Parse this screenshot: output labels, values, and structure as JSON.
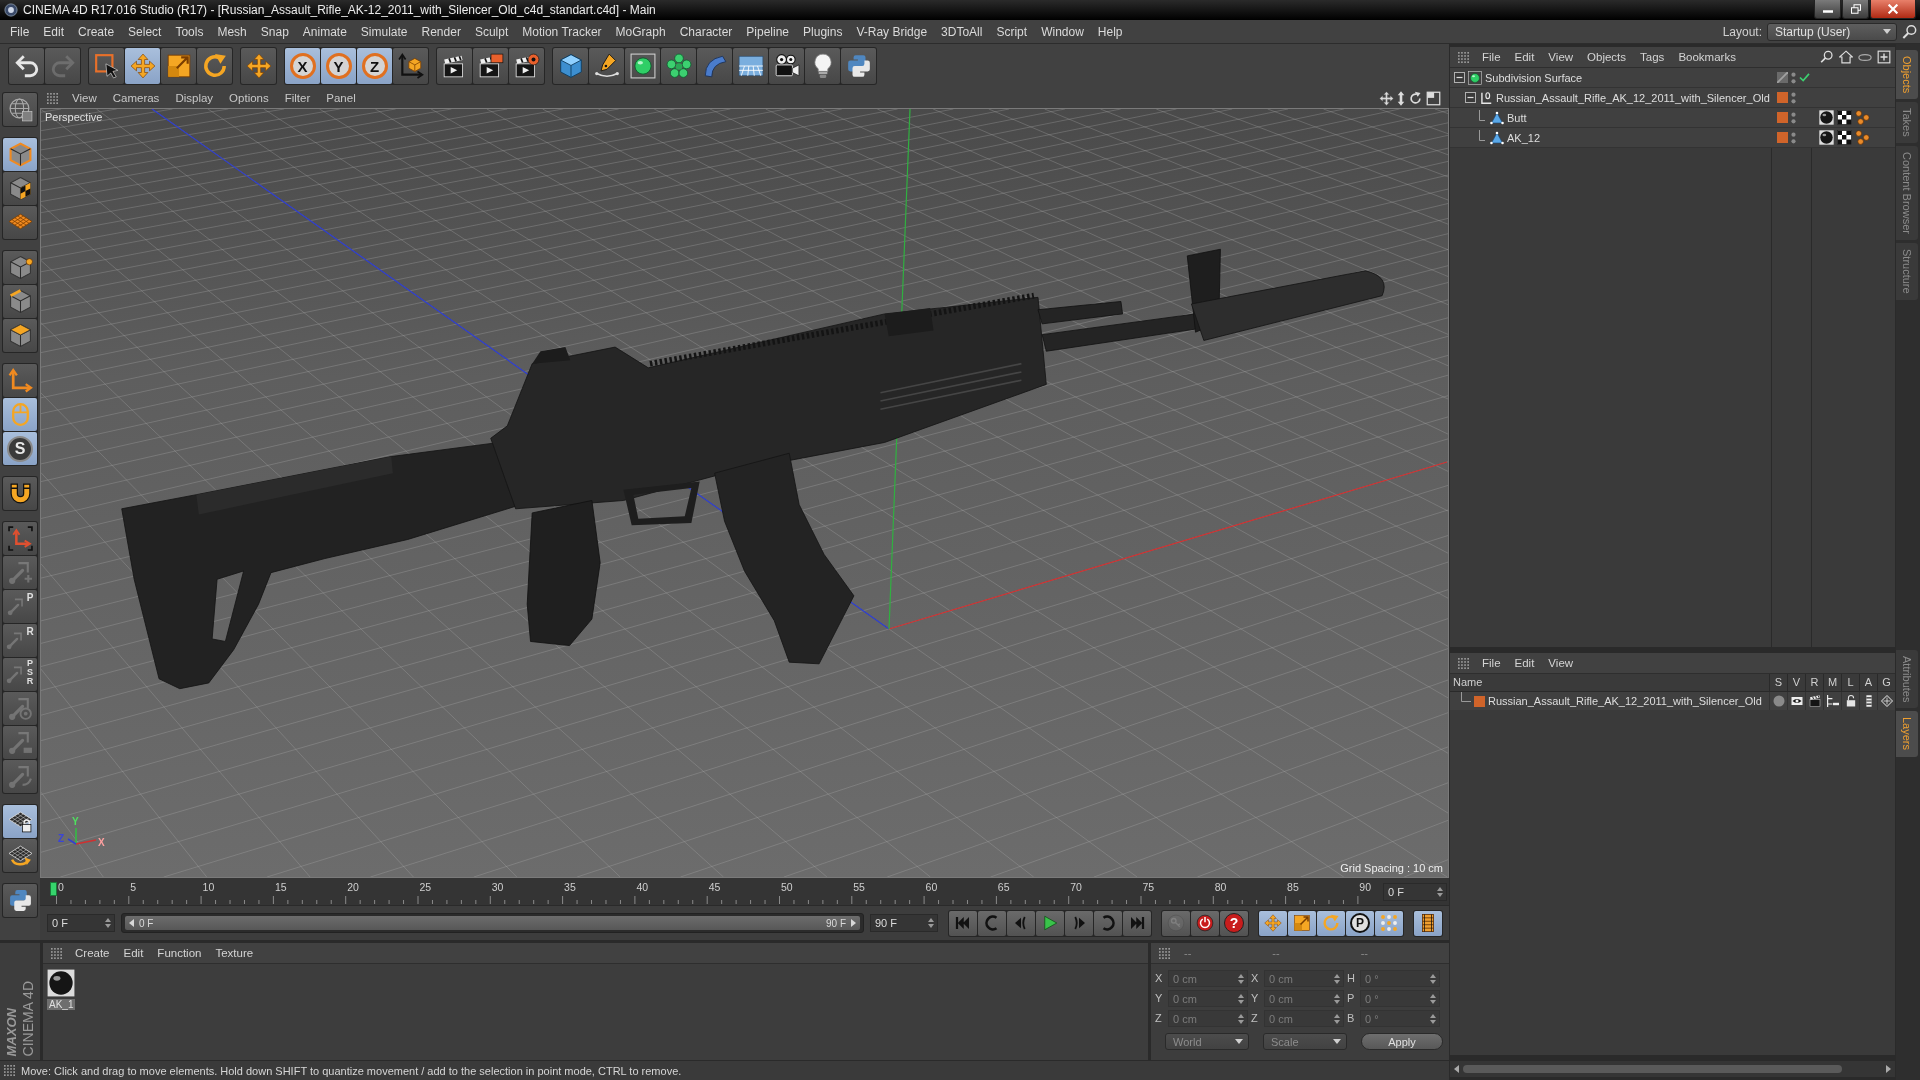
{
  "window": {
    "title": "CINEMA 4D R17.016 Studio (R17) - [Russian_Assault_Rifle_AK-12_2011_with_Silencer_Old_c4d_standart.c4d] - Main"
  },
  "menu_bar": {
    "items": [
      "File",
      "Edit",
      "Create",
      "Select",
      "Tools",
      "Mesh",
      "Snap",
      "Animate",
      "Simulate",
      "Render",
      "Sculpt",
      "Motion Tracker",
      "MoGraph",
      "Character",
      "Pipeline",
      "Plugins",
      "V-Ray Bridge",
      "3DToAll",
      "Script",
      "Window",
      "Help"
    ],
    "layout_label": "Layout:",
    "layout_value": "Startup (User)"
  },
  "toolbar": {
    "groups": [
      [
        {
          "kind": "undo",
          "selected": false,
          "disabled": false
        },
        {
          "kind": "redo",
          "selected": false,
          "disabled": true
        }
      ],
      [
        {
          "kind": "select",
          "selected": false,
          "disabled": false
        },
        {
          "kind": "move",
          "selected": true,
          "disabled": false
        },
        {
          "kind": "scale",
          "selected": false,
          "disabled": false
        },
        {
          "kind": "rotate",
          "selected": false,
          "disabled": false
        }
      ],
      [
        {
          "kind": "recent",
          "selected": false,
          "disabled": false
        }
      ],
      [
        {
          "kind": "x-axis",
          "label": "X",
          "selected": true,
          "disabled": false
        },
        {
          "kind": "y-axis",
          "label": "Y",
          "selected": true,
          "disabled": false
        },
        {
          "kind": "z-axis",
          "label": "Z",
          "selected": true,
          "disabled": false
        },
        {
          "kind": "coordinates",
          "selected": false,
          "disabled": false
        }
      ],
      [
        {
          "kind": "render-view",
          "selected": false,
          "disabled": false
        },
        {
          "kind": "render-picture",
          "selected": false,
          "disabled": false
        },
        {
          "kind": "render-settings",
          "selected": false,
          "disabled": false
        }
      ],
      [
        {
          "kind": "cube",
          "selected": false,
          "disabled": false
        },
        {
          "kind": "pen",
          "selected": false,
          "disabled": false
        },
        {
          "kind": "subdivision",
          "selected": false,
          "disabled": false
        },
        {
          "kind": "cloner",
          "selected": false,
          "disabled": false
        },
        {
          "kind": "deformer",
          "selected": false,
          "disabled": false
        },
        {
          "kind": "floor",
          "selected": false,
          "disabled": false
        },
        {
          "kind": "camera",
          "selected": false,
          "disabled": false
        },
        {
          "kind": "light",
          "selected": false,
          "disabled": false
        },
        {
          "kind": "python",
          "selected": false,
          "disabled": false
        }
      ]
    ]
  },
  "left_toolbar": {
    "groups": [
      [
        {
          "kind": "globe",
          "selected": false,
          "disabled": false
        }
      ],
      [
        {
          "kind": "model",
          "selected": true,
          "disabled": false
        },
        {
          "kind": "texture",
          "selected": false,
          "disabled": false
        },
        {
          "kind": "workplane",
          "selected": false,
          "disabled": false
        }
      ],
      [
        {
          "kind": "points",
          "selected": false,
          "disabled": false
        },
        {
          "kind": "edges",
          "selected": false,
          "disabled": false
        },
        {
          "kind": "polygons",
          "selected": false,
          "disabled": false
        }
      ],
      [
        {
          "kind": "axis",
          "selected": false,
          "disabled": false
        },
        {
          "kind": "tweak",
          "selected": true,
          "disabled": false
        },
        {
          "kind": "snap",
          "label": "S",
          "selected": true,
          "disabled": false
        }
      ],
      [
        {
          "kind": "magnet",
          "selected": false,
          "disabled": false
        }
      ],
      [
        {
          "kind": "workplane-axis",
          "selected": false,
          "disabled": false
        },
        {
          "kind": "bone-add",
          "selected": false,
          "disabled": true
        },
        {
          "kind": "bone-position",
          "label": "P",
          "selected": false,
          "disabled": true
        },
        {
          "kind": "bone-rotation",
          "label": "R",
          "selected": false,
          "disabled": true
        },
        {
          "kind": "bone-psr",
          "label": "PSR",
          "selected": false,
          "disabled": true
        },
        {
          "kind": "bone-target",
          "selected": false,
          "disabled": true
        },
        {
          "kind": "bone-ik",
          "selected": false,
          "disabled": true
        },
        {
          "kind": "bone-bend",
          "selected": false,
          "disabled": true
        }
      ],
      [
        {
          "kind": "grid-lock",
          "selected": true,
          "disabled": false
        },
        {
          "kind": "grid-rotate",
          "selected": false,
          "disabled": false
        }
      ],
      [
        {
          "kind": "python",
          "selected": false,
          "disabled": false
        }
      ]
    ]
  },
  "viewport": {
    "menu": [
      "View",
      "Cameras",
      "Display",
      "Options",
      "Filter",
      "Panel"
    ],
    "camera": "Perspective",
    "grid_spacing": "Grid Spacing : 10 cm",
    "axis_labels": [
      "Y",
      "Z",
      "X"
    ]
  },
  "timeline": {
    "ticks": [
      "0",
      "5",
      "10",
      "15",
      "20",
      "25",
      "30",
      "35",
      "40",
      "45",
      "50",
      "55",
      "60",
      "65",
      "70",
      "75",
      "80",
      "85",
      "90"
    ],
    "level": 0,
    "current_frame": "0 F",
    "start": "0 F",
    "range": {
      "start": "0 F",
      "end": "90 F",
      "level": 1
    },
    "end": "90 F",
    "playback": [
      {
        "kind": "go-start",
        "selected": false,
        "disabled": false
      },
      {
        "kind": "previous-key",
        "selected": false,
        "disabled": false
      },
      {
        "kind": "previous-frame",
        "selected": false,
        "disabled": false
      },
      {
        "kind": "play",
        "selected": false,
        "disabled": false
      },
      {
        "kind": "next-frame",
        "selected": false,
        "disabled": false
      },
      {
        "kind": "next-key",
        "selected": false,
        "disabled": false
      },
      {
        "kind": "go-end",
        "selected": false,
        "disabled": false
      }
    ],
    "record": [
      {
        "kind": "record-objects",
        "selected": false,
        "disabled": true
      },
      {
        "kind": "autokey",
        "selected": false,
        "disabled": false
      },
      {
        "kind": "keyframe-selection",
        "label": "?",
        "selected": false,
        "disabled": false
      }
    ],
    "keys": [
      {
        "kind": "key-position",
        "selected": true,
        "disabled": false
      },
      {
        "kind": "key-scale",
        "selected": true,
        "disabled": false
      },
      {
        "kind": "key-rotation",
        "selected": true,
        "disabled": false
      },
      {
        "kind": "key-parameter",
        "label": "P",
        "selected": true,
        "disabled": false
      },
      {
        "kind": "key-point-level",
        "selected": true,
        "disabled": false
      }
    ],
    "view": [
      {
        "kind": "timeline-view",
        "selected": true,
        "disabled": false
      }
    ]
  },
  "materials": {
    "menu": [
      "Create",
      "Edit",
      "Function",
      "Texture"
    ],
    "items": [
      {
        "name": "AK_1",
        "selected": true
      }
    ]
  },
  "coordinates": {
    "headers": [
      "--",
      "--",
      "--"
    ],
    "rows": [
      {
        "position_axis": "X",
        "position": "0 cm",
        "size_axis": "X",
        "size": "0 cm",
        "rotation_axis": "H",
        "rotation": "0 °"
      },
      {
        "position_axis": "Y",
        "position": "0 cm",
        "size_axis": "Y",
        "size": "0 cm",
        "rotation_axis": "P",
        "rotation": "0 °"
      },
      {
        "position_axis": "Z",
        "position": "0 cm",
        "size_axis": "Z",
        "size": "0 cm",
        "rotation_axis": "B",
        "rotation": "0 °"
      }
    ],
    "mode": "World",
    "transform": "Scale",
    "apply": "Apply"
  },
  "logo": {
    "brand": "MAXON",
    "product": "CINEMA 4D"
  },
  "status_bar": "Move: Click and drag to move elements. Hold down SHIFT to quantize movement / add to the selection in point mode, CTRL to remove.",
  "object_manager": {
    "menu": [
      "File",
      "Edit",
      "View",
      "Objects",
      "Tags",
      "Bookmarks"
    ],
    "objects": [
      {
        "name": "Subdivision Surface",
        "kind": "subdivision",
        "expanded": true,
        "enabled": true,
        "children": [
          {
            "name": "Russian_Assault_Rifle_AK_12_2011_with_Silencer_Old",
            "kind": "null",
            "expanded": true,
            "color": "#d0642a",
            "children": [
              {
                "name": "Butt",
                "kind": "polygon",
                "color": "#d0642a",
                "tags": [
                  {
                    "kind": "material"
                  },
                  {
                    "kind": "uvw"
                  },
                  {
                    "kind": "phong"
                  }
                ]
              },
              {
                "name": "AK_12",
                "kind": "polygon",
                "color": "#d0642a",
                "tags": [
                  {
                    "kind": "material"
                  },
                  {
                    "kind": "uvw"
                  },
                  {
                    "kind": "phong"
                  }
                ]
              }
            ]
          }
        ]
      }
    ]
  },
  "layer_manager": {
    "menu": [
      "File",
      "Edit",
      "View"
    ],
    "columns": [
      "Name",
      "S",
      "V",
      "R",
      "M",
      "L",
      "A",
      "G"
    ],
    "layers": [
      {
        "name": "Russian_Assault_Rifle_AK_12_2011_with_Silencer_Old",
        "color": "#d0642a",
        "solo": false,
        "visible": true,
        "render": true,
        "manager": true,
        "locked": false,
        "animation": true,
        "generators": true
      }
    ]
  },
  "side_tabs": {
    "upper": [
      {
        "label": "Objects",
        "selected": true
      },
      {
        "label": "Takes",
        "selected": false
      },
      {
        "label": "Content Browser",
        "selected": false
      },
      {
        "label": "Structure",
        "selected": false
      }
    ],
    "lower": [
      {
        "label": "Attributes",
        "selected": false
      },
      {
        "label": "Layers",
        "selected": true
      }
    ]
  }
}
